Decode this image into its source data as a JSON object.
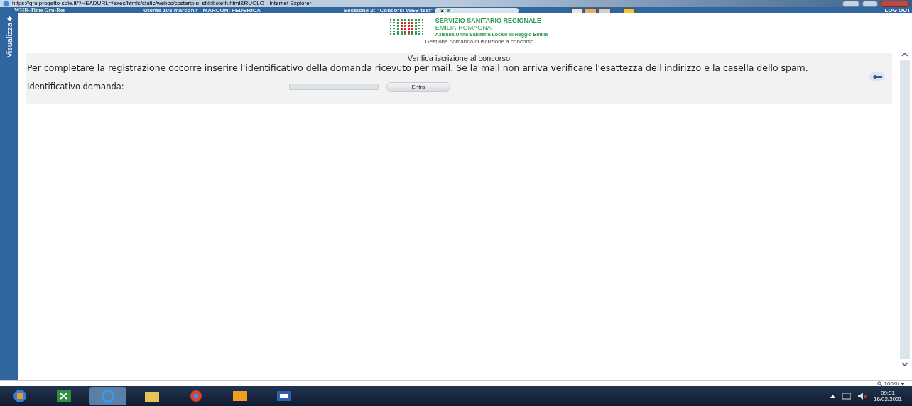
{
  "window": {
    "title": "https://gru.progetto-sole.it/?HEADURL=/exec/htmls/static/webcc/ccstartpju_shibboleth.html&RUOLO - Internet Explorer"
  },
  "app_bar": {
    "app_name": "WHR-Time Gru-Rer",
    "user": "Utente 103.marconif - MARCONI FEDERICA",
    "session": "Sessione 2: \"Concorsi WEB test\"",
    "session_count": "3",
    "logout": "LOG OUT"
  },
  "side_tab": {
    "label": "Visualizza"
  },
  "header": {
    "org": "SERVIZIO SANITARIO REGIONALE",
    "region": "EMILIA-ROMAGNA",
    "unit": "Azienda Unità Sanitaria Locale di Reggio Emilia",
    "subtitle": "Gestione domanda di iscrizione a concorso"
  },
  "form": {
    "title": "Verifica iscrizione al concorso",
    "message": "Per completare la registrazione occorre inserire l'identificativo della domanda ricevuto per mail. Se la mail non arriva verificare l'esattezza dell'indirizzo e la casella dello spam.",
    "field_label": "Identificativo domanda:",
    "submit": "Entra"
  },
  "status_bar": {
    "zoom": "100%"
  },
  "taskbar": {
    "time": "09:31",
    "date": "16/02/2021"
  }
}
